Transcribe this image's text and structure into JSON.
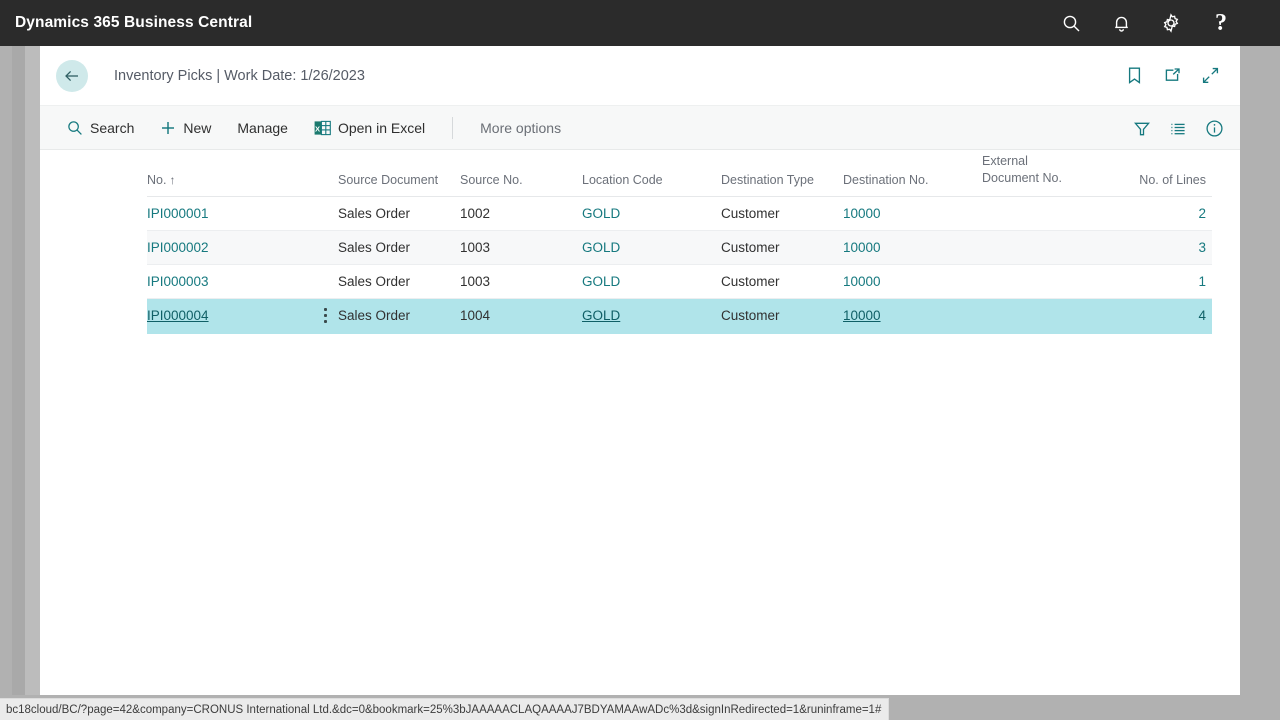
{
  "appbar": {
    "brand": "Dynamics 365 Business Central",
    "icons": [
      {
        "name": "search-icon",
        "glyph": "search"
      },
      {
        "name": "notification-icon",
        "glyph": "bell"
      },
      {
        "name": "settings-icon",
        "glyph": "gear"
      },
      {
        "name": "help-icon",
        "glyph": "question",
        "label": "?"
      }
    ]
  },
  "page_header": {
    "back_label": "Back",
    "title": "Inventory Picks | Work Date: 1/26/2023",
    "icons": [
      {
        "name": "bookmark-icon",
        "glyph": "bookmark"
      },
      {
        "name": "open-new-window-icon",
        "glyph": "open-external"
      },
      {
        "name": "collapse-icon",
        "glyph": "collapse"
      }
    ]
  },
  "toolbar": {
    "search_label": "Search",
    "new_label": "New",
    "manage_label": "Manage",
    "excel_label": "Open in Excel",
    "more_options_label": "More options",
    "right_icons": [
      {
        "name": "filter-icon",
        "glyph": "funnel"
      },
      {
        "name": "list-view-icon",
        "glyph": "lines"
      },
      {
        "name": "info-icon",
        "glyph": "info"
      }
    ]
  },
  "grid": {
    "columns": [
      {
        "key": "no",
        "label": "No.",
        "sort": "↑",
        "align": "left"
      },
      {
        "key": "src_doc",
        "label": "Source Document",
        "align": "left"
      },
      {
        "key": "src_no",
        "label": "Source No.",
        "align": "left"
      },
      {
        "key": "loc",
        "label": "Location Code",
        "align": "left"
      },
      {
        "key": "dest_type",
        "label": "Destination Type",
        "align": "left"
      },
      {
        "key": "dest_no",
        "label": "Destination No.",
        "align": "left"
      },
      {
        "key": "ext_doc_1",
        "label": "External",
        "align": "left"
      },
      {
        "key": "ext_doc_2",
        "label": "Document No.",
        "align": "left"
      },
      {
        "key": "lines",
        "label": "No. of Lines",
        "align": "right"
      }
    ],
    "rows": [
      {
        "no": "IPI000001",
        "src_doc": "Sales Order",
        "src_no": "1002",
        "loc": "GOLD",
        "dest_type": "Customer",
        "dest_no": "10000",
        "ext_doc": "",
        "lines": "2",
        "selected": false
      },
      {
        "no": "IPI000002",
        "src_doc": "Sales Order",
        "src_no": "1003",
        "loc": "GOLD",
        "dest_type": "Customer",
        "dest_no": "10000",
        "ext_doc": "",
        "lines": "3",
        "selected": false
      },
      {
        "no": "IPI000003",
        "src_doc": "Sales Order",
        "src_no": "1003",
        "loc": "GOLD",
        "dest_type": "Customer",
        "dest_no": "10000",
        "ext_doc": "",
        "lines": "1",
        "selected": false
      },
      {
        "no": "IPI000004",
        "src_doc": "Sales Order",
        "src_no": "1004",
        "loc": "GOLD",
        "dest_type": "Customer",
        "dest_no": "10000",
        "ext_doc": "",
        "lines": "4",
        "selected": true
      }
    ]
  },
  "statusbar": {
    "url": "bc18cloud/BC/?page=42&company=CRONUS International Ltd.&dc=0&bookmark=25%3bJAAAAACLAQAAAAJ7BDYAMAAwADc%3d&signInRedirected=1&runinframe=1#"
  },
  "colors": {
    "appbar_bg": "#2b2b2b",
    "accent_teal": "#16797f",
    "selection_bg": "#b0e4ea",
    "row_alt_bg": "#f7f8f9",
    "toolbar_bg": "#f7f8f8",
    "chrome_gray": "#b1b1b1"
  }
}
